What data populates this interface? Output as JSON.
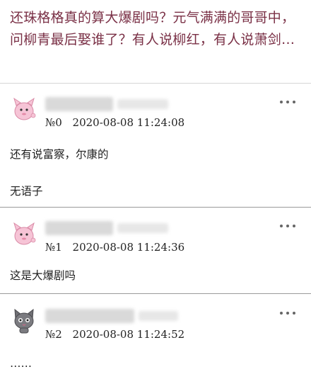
{
  "post": {
    "title": "还珠格格真的算大爆剧吗？元气满满的哥哥中，问柳青最后娶谁了？有人说柳红，有人说萧剑…"
  },
  "comments": [
    {
      "floor": "№0",
      "datetime": "2020-08-08 11:24:08",
      "avatar_icon": "pink-cartoon-creature-icon",
      "paragraphs": [
        "还有说富察，尔康的",
        "无语子"
      ]
    },
    {
      "floor": "№1",
      "datetime": "2020-08-08 11:24:36",
      "avatar_icon": "pink-cartoon-creature-icon",
      "paragraphs": [
        "这是大爆剧吗"
      ]
    },
    {
      "floor": "№2",
      "datetime": "2020-08-08 11:24:52",
      "avatar_icon": "gray-cat-icon",
      "paragraphs": [
        "……"
      ]
    }
  ]
}
